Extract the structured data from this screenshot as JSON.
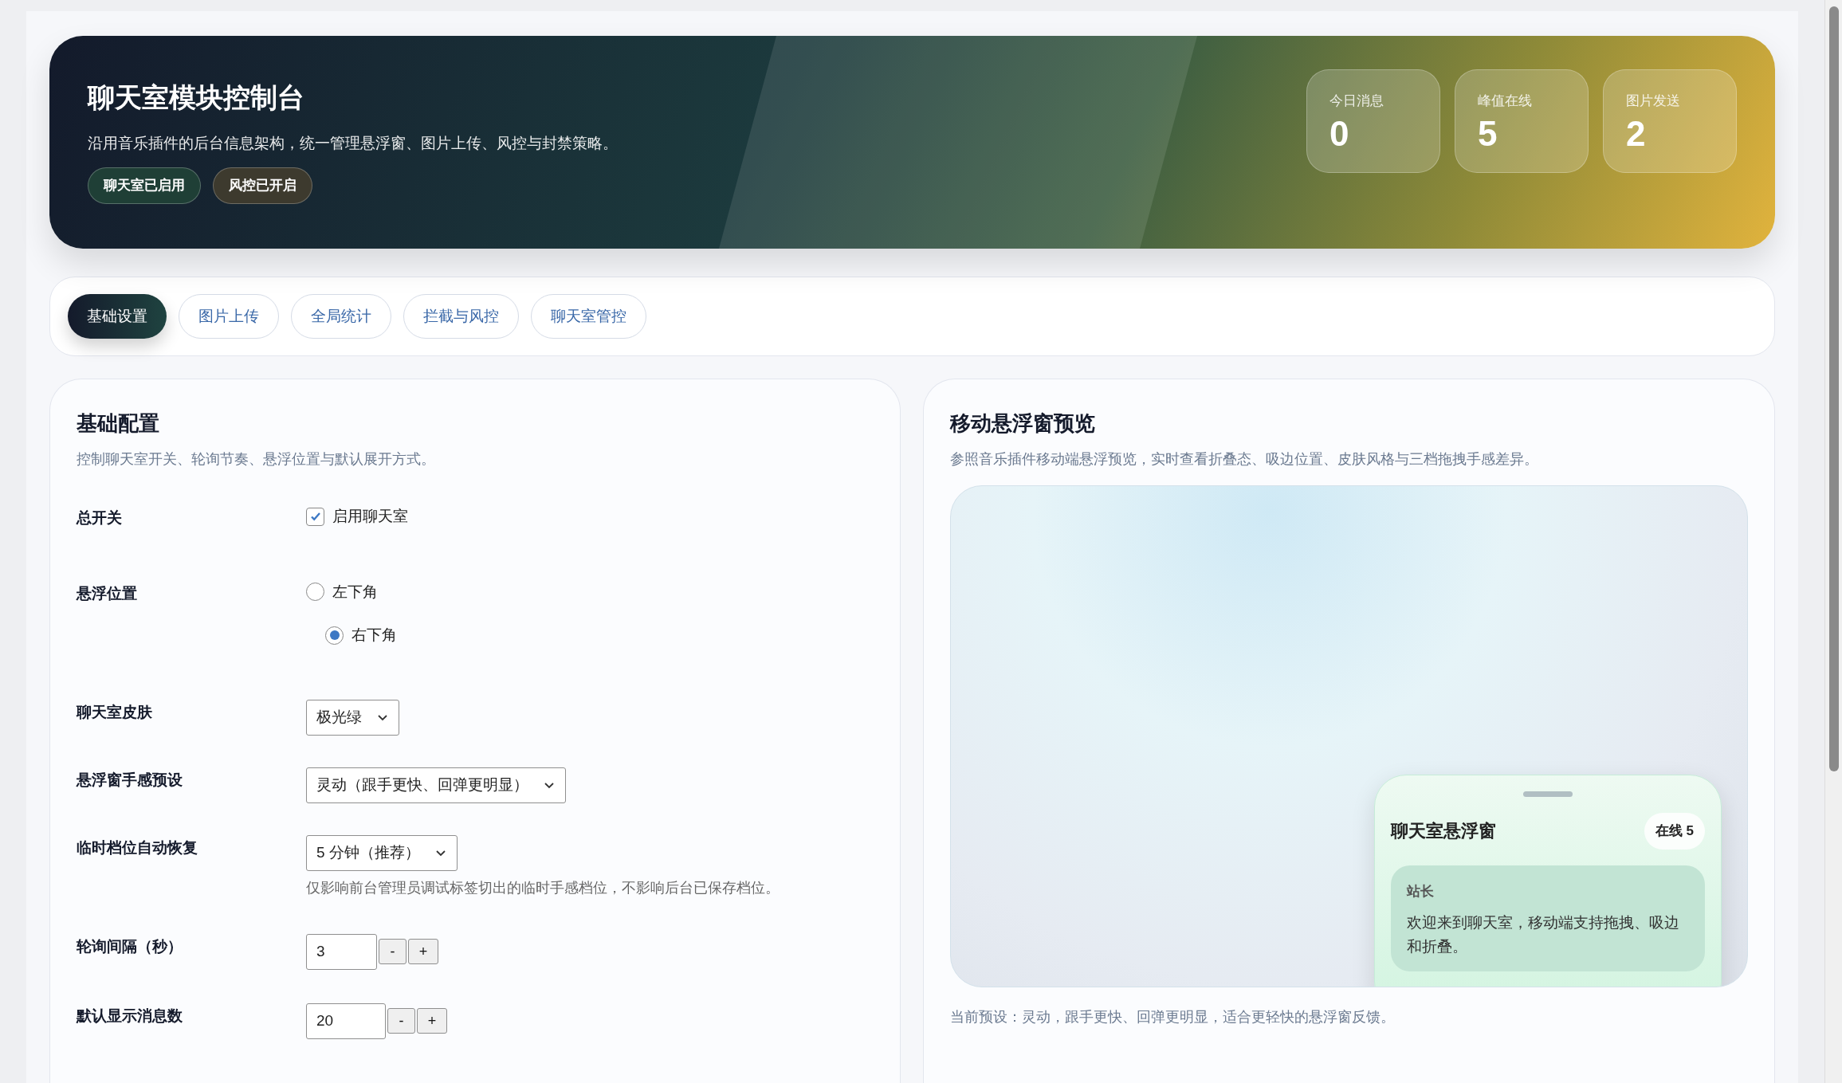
{
  "header": {
    "title": "聊天室模块控制台",
    "subtitle": "沿用音乐插件的后台信息架构，统一管理悬浮窗、图片上传、风控与封禁策略。",
    "badges": [
      {
        "label": "聊天室已启用",
        "color": "#1f3f36"
      },
      {
        "label": "风控已开启",
        "color": "#3d3a2e"
      }
    ]
  },
  "stats": [
    {
      "label": "今日消息",
      "value": "0"
    },
    {
      "label": "峰值在线",
      "value": "5"
    },
    {
      "label": "图片发送",
      "value": "2"
    }
  ],
  "tabs": [
    {
      "label": "基础设置",
      "selected": true
    },
    {
      "label": "图片上传",
      "selected": false
    },
    {
      "label": "全局统计",
      "selected": false
    },
    {
      "label": "拦截与风控",
      "selected": false
    },
    {
      "label": "聊天室管控",
      "selected": false
    }
  ],
  "basic": {
    "title": "基础配置",
    "description": "控制聊天室开关、轮询节奏、悬浮位置与默认展开方式。",
    "rows": [
      {
        "kind": "checkbox",
        "label": "总开关",
        "options": [
          {
            "label": "启用聊天室",
            "checked": true
          }
        ]
      },
      {
        "kind": "radio",
        "label": "悬浮位置",
        "options": [
          {
            "label": "左下角",
            "selected": false
          },
          {
            "label": "右下角",
            "selected": true
          }
        ]
      },
      {
        "kind": "select",
        "label": "聊天室皮肤",
        "value": "极光绿"
      },
      {
        "kind": "select",
        "label": "悬浮窗手感预设",
        "value": "灵动（跟手更快、回弹更明显）"
      },
      {
        "kind": "select",
        "label": "临时档位自动恢复",
        "value": "5 分钟（推荐）",
        "hint": "仅影响前台管理员调试标签切出的临时手感档位，不影响后台已保存档位。"
      },
      {
        "kind": "number",
        "label": "轮询间隔（秒）",
        "value": "3",
        "minus": "-",
        "plus": "+"
      },
      {
        "kind": "number",
        "label": "默认显示消息数",
        "value": "20",
        "minus": "-",
        "plus": "+"
      }
    ]
  },
  "preview": {
    "title": "移动悬浮窗预览",
    "description": "参照音乐插件移动端悬浮预览，实时查看折叠态、吸边位置、皮肤风格与三档拖拽手感差异。",
    "float": {
      "title": "聊天室悬浮窗",
      "badge": "在线 5",
      "messages": [
        {
          "author": "站长",
          "text": "欢迎来到聊天室，移动端支持拖拽、吸边和折叠。"
        }
      ]
    },
    "note": "当前预设：灵动，跟手更快、回弹更明显，适合更轻快的悬浮窗反馈。"
  }
}
